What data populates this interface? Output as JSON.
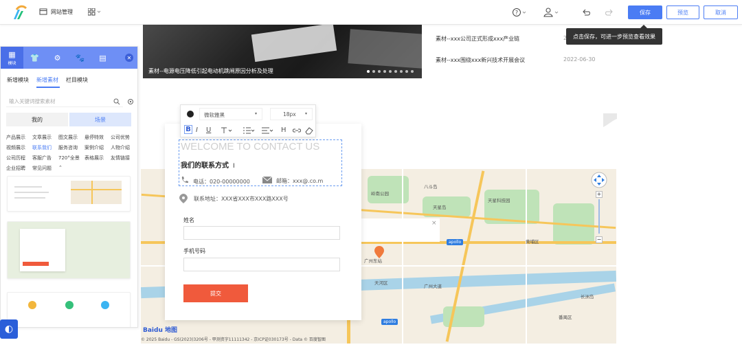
{
  "topbar": {
    "site_manage": "网站管理",
    "save": "保存",
    "preview": "预览",
    "cancel": "取消"
  },
  "tooltip": "点击保存，可进一步预览查看效果",
  "hero": {
    "caption": "素材--电源电压降低引起电动机跳闸原因分析及处理",
    "dots": 9
  },
  "news": [
    {
      "title": "素材--xxx公司正式形成xxx产业链",
      "date": "2"
    },
    {
      "title": "素材--xxx围绕xxx新兴技术开展会议",
      "date": "2022-06-30"
    }
  ],
  "left_panel": {
    "active_icon_label": "模块",
    "tabs": [
      "新增模块",
      "新增素材",
      "栏目模块"
    ],
    "active_tab": "新增素材",
    "search_placeholder": "输入关键词搜索素材",
    "segments": [
      "我的",
      "场景"
    ],
    "categories": [
      [
        "产品展示",
        "文章展示",
        "图文展示",
        "悬停特效",
        "公司优势"
      ],
      [
        "视频展示",
        "联系我们",
        "服务咨询",
        "案例介绍",
        "人物介绍"
      ],
      [
        "公司历程",
        "客服广告",
        "720°全景",
        "表格展示",
        "友情链接"
      ],
      [
        "企业招聘",
        "常见问题"
      ]
    ],
    "active_category": "联系我们"
  },
  "editor": {
    "font_family": "微软雅黑",
    "font_size": "18px",
    "format_buttons": [
      "B",
      "I",
      "U",
      "H"
    ]
  },
  "contact": {
    "welcome": "WELCOME TO CONTACT US",
    "heading": "我们的联系方式",
    "phone": "电话：020-00000000",
    "email": "邮箱：xxx@.co.m",
    "address": "联系地址：XXX省XXX市XXX路XXX号",
    "name_label": "姓名",
    "phone_label": "手机号码",
    "submit": "提交"
  },
  "map": {
    "labels": [
      "八斗岛",
      "天星岛",
      "岭南公园",
      "天星科技园",
      "黄埔区",
      "天河区",
      "广州东站",
      "广州大道",
      "天河公园",
      "番禺区",
      "长洲岛"
    ],
    "apollo": "apollo",
    "footer": "© 2025 Baidu - GS(2023)3206号 - 甲测资字11111342 - 京ICP证030173号 - Data © 百度智图",
    "logo": "Baidu 地图"
  },
  "colors": {
    "primary": "#4a7cf4",
    "panel_header": "#6e8ff5",
    "submit": "#f05a3c"
  }
}
